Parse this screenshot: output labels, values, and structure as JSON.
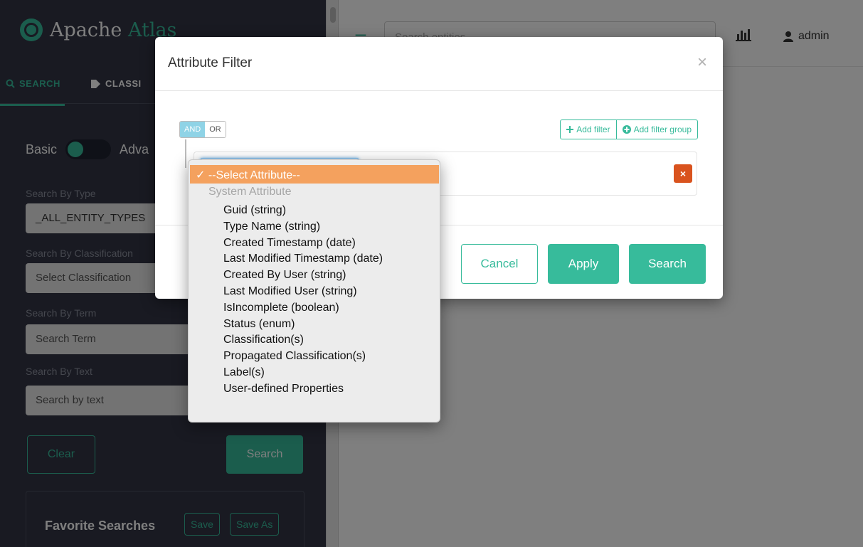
{
  "sidebar": {
    "brand_first": "Apache ",
    "brand_second": "Atlas",
    "tab_search": "SEARCH",
    "tab_classification": "CLASSI",
    "toggle_basic": "Basic",
    "toggle_advanced": "Adva",
    "type_label": "Search By Type",
    "type_value": "_ALL_ENTITY_TYPES",
    "classification_label": "Search By Classification",
    "classification_placeholder": "Select Classification",
    "term_label": "Search By Term",
    "term_placeholder": "Search Term",
    "text_label": "Search By Text",
    "text_placeholder": "Search by text",
    "clear_button": "Clear",
    "search_button": "Search",
    "favorites_title": "Favorite Searches",
    "save_button": "Save",
    "save_as_button": "Save As"
  },
  "header": {
    "search_placeholder": "Search entities",
    "user": "admin"
  },
  "modal": {
    "title": "Attribute Filter",
    "close": "×",
    "and_label": "AND",
    "or_label": "OR",
    "add_filter": "Add filter",
    "add_filter_group": "Add filter group",
    "delete_icon": "×",
    "cancel": "Cancel",
    "apply": "Apply",
    "search": "Search"
  },
  "dropdown": {
    "selected": "✓ --Select Attribute--",
    "group_label": "System Attribute",
    "options": [
      "Guid (string)",
      "Type Name (string)",
      "Created Timestamp (date)",
      "Last Modified Timestamp (date)",
      "Created By User (string)",
      "Last Modified User (string)",
      "IsIncomplete (boolean)",
      "Status (enum)",
      "Classification(s)",
      "Propagated Classification(s)",
      "Label(s)",
      "User-defined Properties"
    ]
  },
  "colors": {
    "accent": "#37bb9b",
    "sidebar_bg": "#323544",
    "selected_option": "#f4a15e",
    "delete": "#d9531e"
  }
}
